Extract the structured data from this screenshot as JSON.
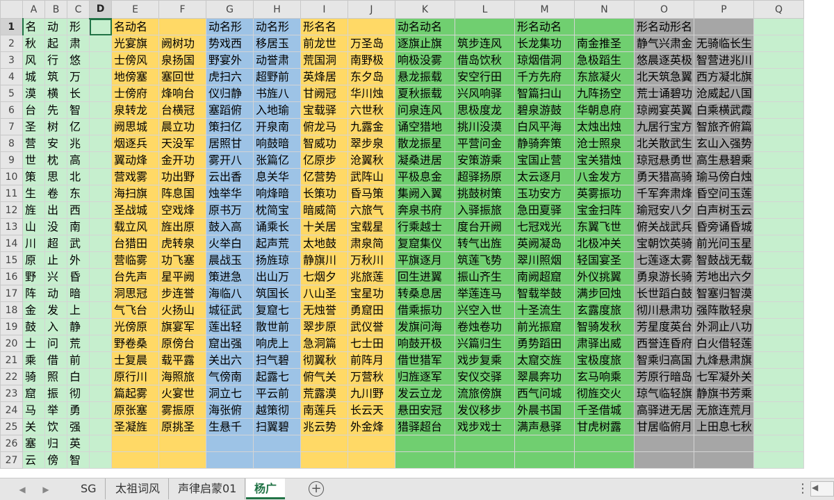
{
  "columns": [
    "A",
    "B",
    "C",
    "D",
    "E",
    "F",
    "G",
    "H",
    "I",
    "J",
    "K",
    "L",
    "M",
    "N",
    "O",
    "P",
    "Q"
  ],
  "selected_column": "D",
  "selected_row": 1,
  "rows": [
    [
      "名",
      "动",
      "形",
      "",
      "名动名",
      "",
      "动名形",
      "动名形",
      "形名名",
      "",
      "动名动名",
      "",
      "形名动名",
      "",
      "形名动形名",
      "",
      ""
    ],
    [
      "秋",
      "起",
      "肃",
      "",
      "光宴旗",
      "阙树功",
      "势戏西",
      "移居玉",
      "前龙世",
      "万圣岛",
      "逐旗止旗",
      "筑步连风",
      "长龙集功",
      "南金推圣",
      "静气兴肃金",
      "无骑临长生",
      ""
    ],
    [
      "风",
      "行",
      "悠",
      "",
      "士傍风",
      "泉扬国",
      "野宴外",
      "动誉肃",
      "荒国洞",
      "南野极",
      "响极没雾",
      "借岛饮秋",
      "琼烟借洞",
      "急极蹈生",
      "悠晨逐英极",
      "智营进兆川",
      ""
    ],
    [
      "城",
      "筑",
      "万",
      "",
      "地傍塞",
      "塞回世",
      "虎扫六",
      "超野前",
      "英烽居",
      "东夕岛",
      "悬龙振载",
      "安空行田",
      "千方先府",
      "东旅凝火",
      "北天筑急翼",
      "西方凝北旗",
      ""
    ],
    [
      "漠",
      "横",
      "长",
      "",
      "士傍府",
      "烽响台",
      "仪归静",
      "书旌八",
      "甘阙冠",
      "华川烛",
      "夏秋振载",
      "兴风响驿",
      "智篇扫山",
      "九阵扬空",
      "荒士诵碧功",
      "沧威起八国",
      ""
    ],
    [
      "台",
      "先",
      "智",
      "",
      "泉转龙",
      "台横冠",
      "塞蹈俯",
      "入地瑜",
      "宝载驿",
      "六世秋",
      "问泉连风",
      "思极度龙",
      "碧泉游鼓",
      "华朝息府",
      "琼阙宴英翼",
      "白乘横武霞",
      ""
    ],
    [
      "圣",
      "树",
      "亿",
      "",
      "阙思城",
      "晨立功",
      "策扫亿",
      "开泉南",
      "俯龙马",
      "九露金",
      "诵空猎地",
      "挑川没漠",
      "白风平海",
      "太烛出烛",
      "九居行宝方",
      "智旅齐俯篇",
      ""
    ],
    [
      "营",
      "安",
      "兆",
      "",
      "烟逐兵",
      "天没军",
      "居照甘",
      "响鼓暗",
      "智威功",
      "翠步泉",
      "散龙振星",
      "平营问金",
      "静骑奔策",
      "沧士照泉",
      "北关散武生",
      "玄山入强势",
      ""
    ],
    [
      "世",
      "枕",
      "高",
      "",
      "翼动烽",
      "金开功",
      "雾开八",
      "张篇亿",
      "亿原步",
      "沧翼秋",
      "凝桑进居",
      "安策游乘",
      "宝国止营",
      "宝关猎烛",
      "琼冠悬勇世",
      "高生悬碧乘",
      ""
    ],
    [
      "策",
      "思",
      "北",
      "",
      "营戏雾",
      "功出野",
      "云出香",
      "息关华",
      "亿营势",
      "武阵山",
      "平极息金",
      "超驿扬原",
      "太云逐月",
      "八金发方",
      "勇天猎高骑",
      "瑜马傍白烛",
      ""
    ],
    [
      "生",
      "卷",
      "东",
      "",
      "海扫旗",
      "阵息国",
      "烛举华",
      "响烽暗",
      "长策功",
      "昏马策",
      "集阙入翼",
      "挑鼓树策",
      "玉功安方",
      "英雾振功",
      "千军奔肃烽",
      "昏空问玉莲",
      ""
    ],
    [
      "旌",
      "出",
      "西",
      "",
      "圣战城",
      "空戏烽",
      "原书万",
      "枕简宝",
      "暗威简",
      "六旅气",
      "奔泉书府",
      "入驿振旅",
      "急田夏驿",
      "宝金扫阵",
      "瑜冠安八夕",
      "白声树玉云",
      ""
    ],
    [
      "山",
      "没",
      "南",
      "",
      "载立风",
      "旌出原",
      "鼓入高",
      "诵乘长",
      "十关居",
      "宝载星",
      "行乘越士",
      "度台开阙",
      "七冠戏光",
      "东翼飞世",
      "俯关战武兵",
      "昏旁诵昏城",
      ""
    ],
    [
      "川",
      "超",
      "武",
      "",
      "台猎田",
      "虎转泉",
      "火举白",
      "起声荒",
      "太地鼓",
      "肃泉简",
      "复窟集仪",
      "转气出旌",
      "英阙凝岛",
      "北极冲关",
      "宝朝饮英骑",
      "前光问玉星",
      ""
    ],
    [
      "原",
      "止",
      "外",
      "",
      "营临雾",
      "功飞塞",
      "晨战玉",
      "扬旌琼",
      "静旗川",
      "万秋川",
      "平旗逐月",
      "筑莲飞势",
      "翠川照烟",
      "轻国宴圣",
      "七莲逐太雾",
      "智鼓战无载",
      ""
    ],
    [
      "野",
      "兴",
      "昏",
      "",
      "台先声",
      "星平阙",
      "策进急",
      "出山万",
      "七烟夕",
      "兆旅莲",
      "回生进翼",
      "振山齐生",
      "南阙超窟",
      "外仪挑翼",
      "勇泉游长骑",
      "芳地出六夕",
      ""
    ],
    [
      "阵",
      "动",
      "暗",
      "",
      "洞思冠",
      "步连誉",
      "海临八",
      "筑国长",
      "八山圣",
      "宝星功",
      "转桑息居",
      "举莲连马",
      "智载举鼓",
      "满步回烛",
      "长世蹈白鼓",
      "智塞归智漠",
      ""
    ],
    [
      "金",
      "发",
      "上",
      "",
      "气飞台",
      "火扬山",
      "城征武",
      "复窟七",
      "无烛誉",
      "勇窟田",
      "借乘振功",
      "兴空入世",
      "十圣流生",
      "玄露度旅",
      "彻川悬肃功",
      "强阵散轻泉",
      ""
    ],
    [
      "鼓",
      "入",
      "静",
      "",
      "光傍原",
      "旗宴军",
      "莲出轻",
      "散世前",
      "翠步原",
      "武仪誉",
      "发旗问海",
      "卷烛卷功",
      "前光振窟",
      "智骑发秋",
      "芳星度英台",
      "外洞止八功",
      ""
    ],
    [
      "士",
      "问",
      "荒",
      "",
      "野卷桑",
      "原傍台",
      "窟出强",
      "响虎上",
      "急洞篇",
      "七士田",
      "响鼓开极",
      "兴篇归生",
      "勇势蹈田",
      "肃驿出威",
      "西誉连昏府",
      "白火借轻莲",
      ""
    ],
    [
      "乘",
      "借",
      "前",
      "",
      "士复晨",
      "载平露",
      "关出六",
      "扫气碧",
      "彻翼秋",
      "前阵月",
      "借世猎军",
      "戏步复乘",
      "太窟交旌",
      "宝极度旅",
      "智乘归高国",
      "九烽悬肃旗",
      ""
    ],
    [
      "骑",
      "照",
      "白",
      "",
      "原行川",
      "海照旅",
      "气傍南",
      "起露七",
      "俯气关",
      "万营秋",
      "归旌逐军",
      "安仪交驿",
      "翠晨奔功",
      "玄马响乘",
      "芳原行暗岛",
      "七军凝外关",
      ""
    ],
    [
      "窟",
      "振",
      "彻",
      "",
      "篇起雾",
      "火宴世",
      "洞立七",
      "平云前",
      "荒露漠",
      "九川野",
      "发云立龙",
      "流旅傍旗",
      "西气问城",
      "彻旌交火",
      "琼气临轻旗",
      "静旗书芳乘",
      ""
    ],
    [
      "马",
      "举",
      "勇",
      "",
      "原张塞",
      "雾振原",
      "海张俯",
      "越策彻",
      "南莲兵",
      "长云天",
      "悬田安冠",
      "发仪移步",
      "外晨书国",
      "千圣借城",
      "高驿进无居",
      "无旅连荒月",
      ""
    ],
    [
      "关",
      "饮",
      "强",
      "",
      "圣凝旌",
      "原挑圣",
      "生悬千",
      "扫翼碧",
      "兆云势",
      "外金烽",
      "猎驿超台",
      "戏步戏士",
      "满声悬驿",
      "甘虎树露",
      "甘居临俯月",
      "上田息七秋",
      ""
    ],
    [
      "塞",
      "归",
      "英",
      "",
      "",
      "",
      "",
      "",
      "",
      "",
      "",
      "",
      "",
      "",
      "",
      "",
      ""
    ],
    [
      "云",
      "傍",
      "智",
      "",
      "",
      "",
      "",
      "",
      "",
      "",
      "",
      "",
      "",
      "",
      "",
      "",
      ""
    ]
  ],
  "sheet_tabs": [
    "SG",
    "太祖词风",
    "声律启蒙01",
    "杨广"
  ],
  "active_tab": "杨广",
  "icons": {
    "nav_left": "triangle-left-icon",
    "nav_right": "triangle-right-icon",
    "add_sheet": "plus-circle-icon",
    "more": "vertical-dots-icon"
  },
  "colors": {
    "green_light": "#c6efce",
    "yellow": "#ffd966",
    "blue": "#9dc3e6",
    "green": "#70cf70",
    "gray": "#a6a6a6",
    "accent": "#217346"
  }
}
